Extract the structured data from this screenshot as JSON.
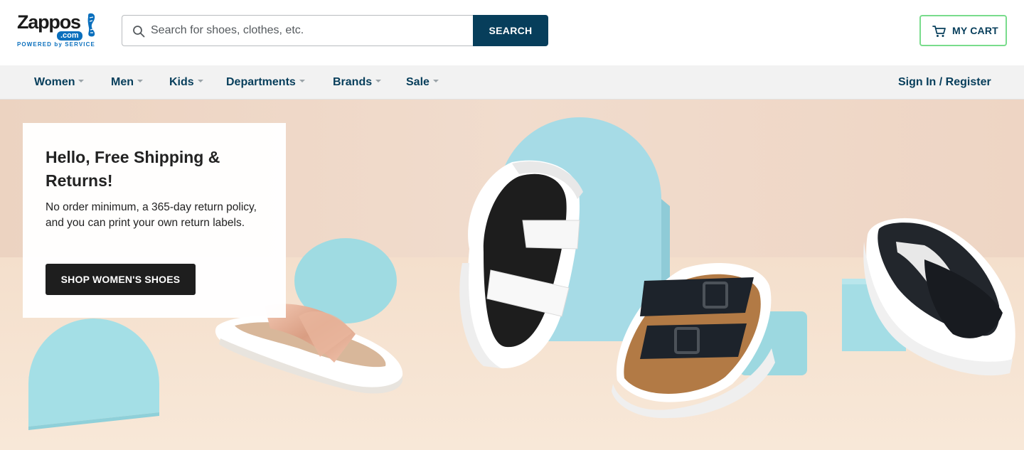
{
  "brand": {
    "wordmark": "Zappos",
    "dotcom": ".com",
    "tagline": "POWERED by SERVICE",
    "colors": {
      "navy": "#073e5b",
      "blue": "#0a6fbd",
      "cart_border": "#79dc8c"
    }
  },
  "search": {
    "placeholder": "Search for shoes, clothes, etc.",
    "value": "",
    "button_label": "SEARCH",
    "icon": "search-icon"
  },
  "cart": {
    "label": "MY CART",
    "icon": "cart-icon"
  },
  "nav": {
    "items": [
      {
        "label": "Women"
      },
      {
        "label": "Men"
      },
      {
        "label": "Kids"
      },
      {
        "label": "Departments"
      },
      {
        "label": "Brands"
      },
      {
        "label": "Sale"
      }
    ],
    "signin": "Sign In / Register"
  },
  "hero": {
    "title": "Hello, Free Shipping & Returns!",
    "body": "No order minimum, a 365-day return policy, and you can print your own return labels.",
    "cta": "SHOP WOMEN'S SHOES",
    "image_subject": "sandals-on-pastel-blocks"
  }
}
